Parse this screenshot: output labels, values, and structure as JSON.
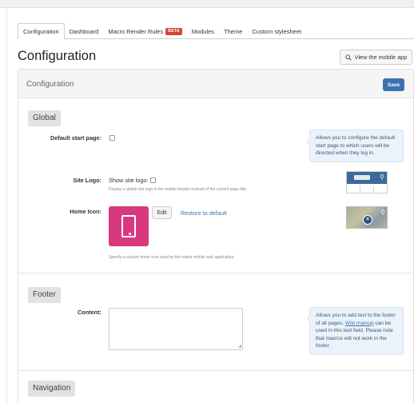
{
  "tabs": [
    {
      "label": "Configuration",
      "active": true
    },
    {
      "label": "Dashboard"
    },
    {
      "label": "Macro Render Rules",
      "badge": "BETA"
    },
    {
      "label": "Modules"
    },
    {
      "label": "Theme"
    },
    {
      "label": "Custom stylesheet"
    }
  ],
  "page": {
    "title": "Configuration",
    "mobile_button": "View the mobile app"
  },
  "panel": {
    "title": "Configuration",
    "save_label": "Save"
  },
  "global": {
    "heading": "Global",
    "default_start_page": {
      "label": "Default start page:",
      "help": "Allows you to configure the default start page to which users will be directed when they log in."
    },
    "site_logo": {
      "label": "Site Logo:",
      "checkbox_label": "Show site logo:",
      "description": "Display a global site logo in the mobile header instead of the current page title."
    },
    "home_icon": {
      "label": "Home Icon:",
      "edit_label": "Edit",
      "restore_label": "Restore to default",
      "description": "Specify a custom home icon used by the native mobile web application."
    }
  },
  "footer": {
    "heading": "Footer",
    "content_label": "Content:",
    "content_value": "",
    "help_before": "Allows you to add text to the footer of all pages. ",
    "help_link": "Wiki markup",
    "help_after": " can be used in this text field. Please note that macros will not work in the footer."
  },
  "navigation": {
    "heading": "Navigation"
  },
  "icons": {
    "search": "search-icon",
    "mobile": "phone-icon"
  },
  "colors": {
    "accent": "#3b73af",
    "badge": "#d04437",
    "home_icon_bg": "#d8397e",
    "help_bg": "#ebf2f9"
  }
}
